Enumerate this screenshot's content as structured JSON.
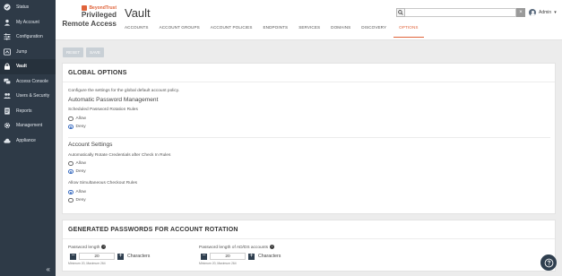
{
  "sidebar": {
    "items": [
      {
        "label": "Status",
        "icon": "check-circle-icon"
      },
      {
        "label": "My Account",
        "icon": "user-icon"
      },
      {
        "label": "Configuration",
        "icon": "sliders-icon"
      },
      {
        "label": "Jump",
        "icon": "jump-icon"
      },
      {
        "label": "Vault",
        "icon": "lock-icon"
      },
      {
        "label": "Access Console",
        "icon": "chat-icon"
      },
      {
        "label": "Users & Security",
        "icon": "users-icon"
      },
      {
        "label": "Reports",
        "icon": "report-icon"
      },
      {
        "label": "Management",
        "icon": "gear-icon"
      },
      {
        "label": "Appliance",
        "icon": "cloud-icon"
      }
    ],
    "active": "Vault",
    "collapse_glyph": "«"
  },
  "brand": {
    "logo_text": "BeyondTrust",
    "line1": "Privileged",
    "line2": "Remote Access",
    "accent": "#e0633a"
  },
  "header": {
    "title": "Vault",
    "tabs": [
      "ACCOUNTS",
      "ACCOUNT GROUPS",
      "ACCOUNT POLICIES",
      "ENDPOINTS",
      "SERVICES",
      "DOMAINS",
      "DISCOVERY",
      "OPTIONS"
    ],
    "active_tab": "OPTIONS",
    "search": {
      "value": "",
      "placeholder": ""
    },
    "user": "Admin"
  },
  "toolbar": {
    "reset_label": "RESET",
    "save_label": "SAVE"
  },
  "global_options": {
    "title": "GLOBAL OPTIONS",
    "description": "Configure the settings for the global default account policy.",
    "auto_password_heading": "Automatic Password Management",
    "scheduled_rotation_label": "Scheduled Password Rotation Rules",
    "scheduled_rotation_options": [
      "Allow",
      "Deny"
    ],
    "scheduled_rotation_selected": "Deny",
    "account_settings_heading": "Account Settings",
    "auto_rotate_label": "Automatically Rotate Credentials after Check In Rules",
    "auto_rotate_options": [
      "Allow",
      "Deny"
    ],
    "auto_rotate_selected": "Deny",
    "simultaneous_label": "Allow Simultaneous Checkout Rules",
    "simultaneous_options": [
      "Allow",
      "Deny"
    ],
    "simultaneous_selected": "Allow"
  },
  "generated_passwords": {
    "title": "GENERATED PASSWORDS FOR ACCOUNT ROTATION",
    "password_length_label": "Password length",
    "password_length_value": "20",
    "password_length_hint": "Minimum 20, Maximum 264",
    "ad_length_label": "Password length of AD/DS accounts",
    "ad_length_value": "20",
    "ad_length_hint": "Minimum 20, Maximum 264",
    "units_label": "Characters",
    "info_glyph": "i"
  }
}
